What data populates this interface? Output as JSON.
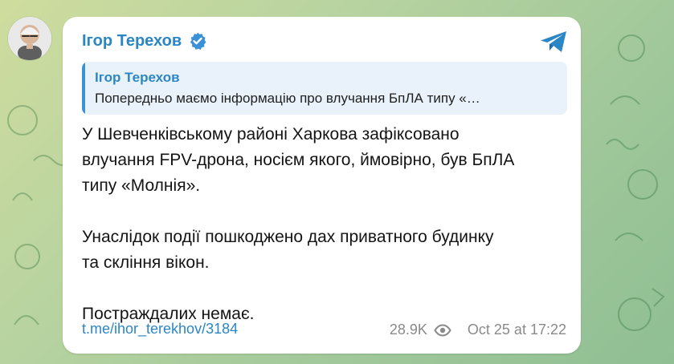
{
  "post": {
    "author": "Ігор Терехов",
    "quote": {
      "author": "Ігор Терехов",
      "text": "Попередньо маємо інформацію про влучання БпЛА типу «…"
    },
    "paragraphs": [
      "У Шевченківському районі Харкова зафіксовано\nвлучання FPV-дрона, носієм якого, ймовірно, був БпЛА\nтипу «Молнія».",
      "Унаслідок події пошкоджено дах приватного будинку\nта скління вікон.",
      "Постраждалих немає."
    ],
    "link": "t.me/ihor_terekhov/3184",
    "views": "28.9K",
    "date": "Oct 25 at 17:22"
  },
  "icons": {
    "verified": "verified-badge-icon",
    "share": "telegram-share-icon",
    "views": "eye-icon"
  },
  "colors": {
    "accent": "#2b86c5",
    "quote_background": "#e9f2fa",
    "quote_bar": "#3a94d4",
    "meta_text": "#8a8a8a"
  }
}
